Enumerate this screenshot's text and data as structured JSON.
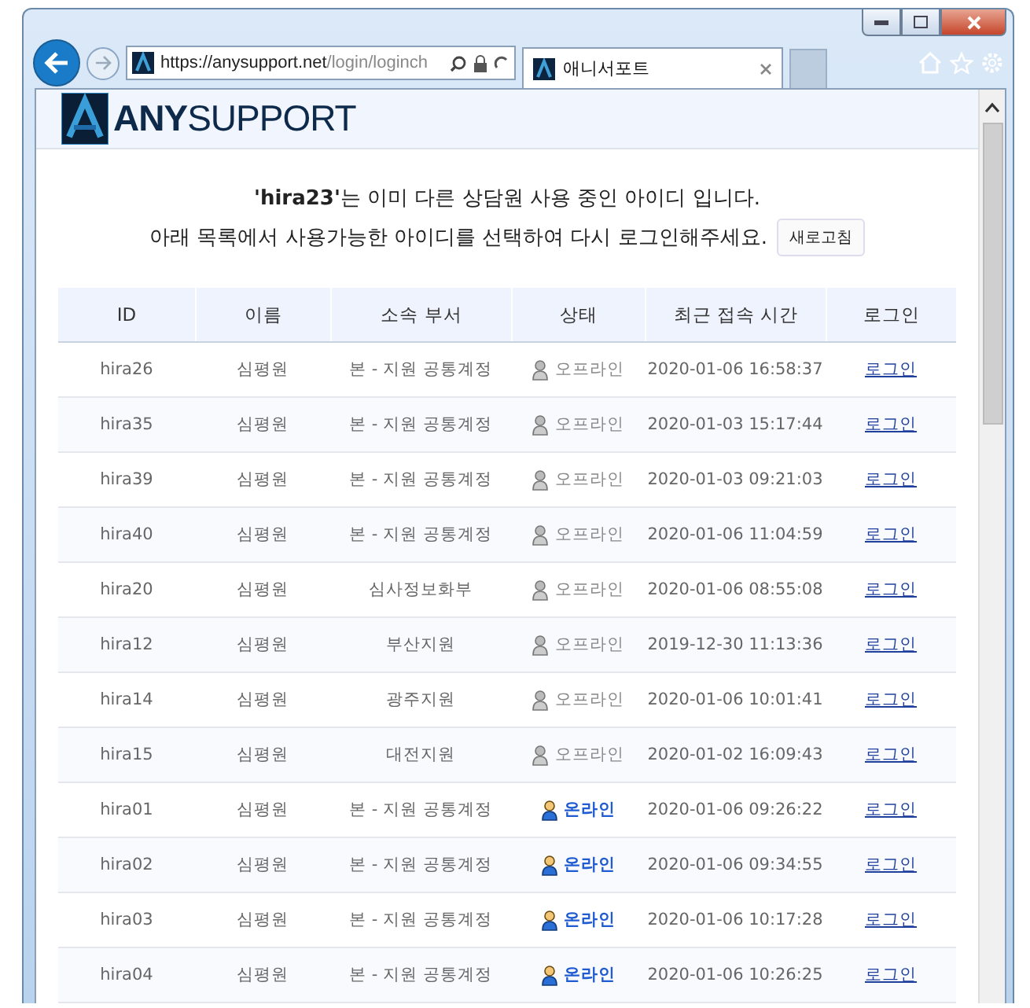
{
  "browser": {
    "address": {
      "host": "https://anysupport.net",
      "path": "/login/loginch"
    },
    "tab": {
      "title": "애니서포트",
      "selected": true
    }
  },
  "logo": {
    "strong": "ANY",
    "rest": "SUPPORT"
  },
  "message": {
    "lines": [
      "**'hira23'**는 이미 다른 상담원 사용 중인 아이디 입니다.",
      "아래 목록에서 사용가능한 아이디를 선택하여 다시 로그인해주세요."
    ],
    "refresh_button": "새로고침"
  },
  "table": {
    "columns": [
      "ID",
      "이름",
      "소속 부서",
      "상태",
      "최근 접속 시간",
      "로그인"
    ],
    "rows": [
      {
        "id": "hira26",
        "name": "심평원",
        "dept": "본 - 지원 공통계정",
        "status": {
          "kind": "offline",
          "label": "오프라인"
        },
        "last_access": "2020-01-06 16:58:37",
        "login": "로그인"
      },
      {
        "id": "hira35",
        "name": "심평원",
        "dept": "본 - 지원 공통계정",
        "status": {
          "kind": "offline",
          "label": "오프라인"
        },
        "last_access": "2020-01-03 15:17:44",
        "login": "로그인"
      },
      {
        "id": "hira39",
        "name": "심평원",
        "dept": "본 - 지원 공통계정",
        "status": {
          "kind": "offline",
          "label": "오프라인"
        },
        "last_access": "2020-01-03 09:21:03",
        "login": "로그인"
      },
      {
        "id": "hira40",
        "name": "심평원",
        "dept": "본 - 지원 공통계정",
        "status": {
          "kind": "offline",
          "label": "오프라인"
        },
        "last_access": "2020-01-06 11:04:59",
        "login": "로그인"
      },
      {
        "id": "hira20",
        "name": "심평원",
        "dept": "심사정보화부",
        "status": {
          "kind": "offline",
          "label": "오프라인"
        },
        "last_access": "2020-01-06 08:55:08",
        "login": "로그인"
      },
      {
        "id": "hira12",
        "name": "심평원",
        "dept": "부산지원",
        "status": {
          "kind": "offline",
          "label": "오프라인"
        },
        "last_access": "2019-12-30 11:13:36",
        "login": "로그인"
      },
      {
        "id": "hira14",
        "name": "심평원",
        "dept": "광주지원",
        "status": {
          "kind": "offline",
          "label": "오프라인"
        },
        "last_access": "2020-01-06 10:01:41",
        "login": "로그인"
      },
      {
        "id": "hira15",
        "name": "심평원",
        "dept": "대전지원",
        "status": {
          "kind": "offline",
          "label": "오프라인"
        },
        "last_access": "2020-01-02 16:09:43",
        "login": "로그인"
      },
      {
        "id": "hira01",
        "name": "심평원",
        "dept": "본 - 지원 공통계정",
        "status": {
          "kind": "online",
          "label": "온라인"
        },
        "last_access": "2020-01-06 09:26:22",
        "login": "로그인"
      },
      {
        "id": "hira02",
        "name": "심평원",
        "dept": "본 - 지원 공통계정",
        "status": {
          "kind": "online",
          "label": "온라인"
        },
        "last_access": "2020-01-06 09:34:55",
        "login": "로그인"
      },
      {
        "id": "hira03",
        "name": "심평원",
        "dept": "본 - 지원 공통계정",
        "status": {
          "kind": "online",
          "label": "온라인"
        },
        "last_access": "2020-01-06 10:17:28",
        "login": "로그인"
      },
      {
        "id": "hira04",
        "name": "심평원",
        "dept": "본 - 지원 공통계정",
        "status": {
          "kind": "online",
          "label": "온라인"
        },
        "last_access": "2020-01-06 10:26:25",
        "login": "로그인"
      }
    ]
  }
}
